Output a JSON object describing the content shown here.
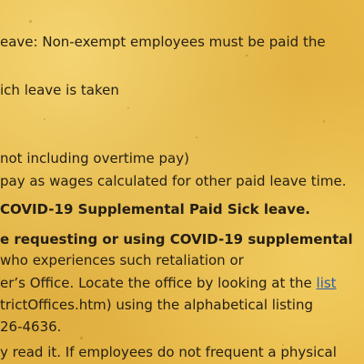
{
  "document": {
    "line1": "eave: Non-exempt employees must be paid the",
    "line2": "ich leave is taken",
    "line3": "not including overtime pay)",
    "line4": "pay as wages calculated for other paid leave time.",
    "line5": "COVID-19 Supplemental Paid Sick leave.",
    "line6": "e requesting or using COVID-19 supplemental",
    "line7": "who experiences such retaliation or",
    "line8_text": "er’s Office. Locate the office by looking at the ",
    "line8_link": "list",
    "line9": "trictOffices.htm) using the alphabetical listing",
    "line10": "26-4636.",
    "line11": "y read it. If employees do not frequent a physical"
  }
}
